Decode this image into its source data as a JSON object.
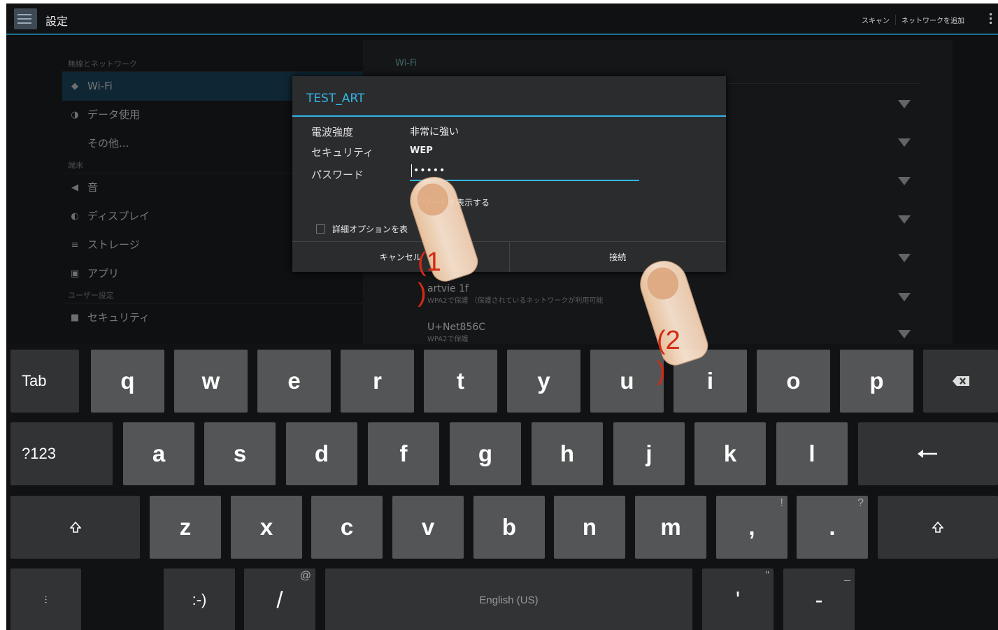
{
  "actionbar": {
    "title": "設定",
    "actions": [
      "スキャン",
      "ネットワークを追加"
    ]
  },
  "settings": {
    "categories": {
      "wireless": "無線とネットワーク",
      "device": "端末",
      "user": "ユーザー設定"
    },
    "items": {
      "wifi": "Wi-Fi",
      "data_usage": "データ使用",
      "more": "その他...",
      "sound": "音",
      "display": "ディスプレイ",
      "storage": "ストレージ",
      "apps": "アプリ",
      "security": "セキュリティ"
    }
  },
  "wifi_panel": {
    "header": "Wi-Fi",
    "networks": [
      {
        "name": "artvie 1f",
        "detail": "WPA2で保護 （保護されているネットワークが利用可能"
      },
      {
        "name": "U+Net856C",
        "detail": "WPA2で保護"
      }
    ]
  },
  "dialog": {
    "title": "TEST_ART",
    "signal_label": "電波強度",
    "signal_value": "非常に強い",
    "security_label": "セキュリティ",
    "security_value": "WEP",
    "password_label": "パスワード",
    "password_value": "•••••",
    "show_password": "ワードを表示する",
    "advanced_options": "詳細オプションを表",
    "cancel": "キャンセル",
    "connect": "接続"
  },
  "keyboard": {
    "row1": [
      "Tab",
      "q",
      "w",
      "e",
      "r",
      "t",
      "y",
      "u",
      "i",
      "o",
      "p"
    ],
    "row2": [
      "?123",
      "a",
      "s",
      "d",
      "f",
      "g",
      "h",
      "j",
      "k",
      "l"
    ],
    "row3": [
      "z",
      "x",
      "c",
      "v",
      "b",
      "n",
      "m",
      ",",
      "."
    ],
    "row3_sup": {
      "comma": "!",
      "period": "?"
    },
    "row4": {
      "smiley": ":-)",
      "slash": "/",
      "slash_sup": "@",
      "space": "English (US)",
      "apostrophe": "'",
      "apostrophe_sup": "\"",
      "dash": "-",
      "dash_sup": "_"
    }
  },
  "annotations": {
    "step1": "(1\n)",
    "step2": "(2\n)"
  },
  "colors": {
    "accent": "#33b5e5",
    "annotation": "#d42a14",
    "key": "#545556"
  }
}
